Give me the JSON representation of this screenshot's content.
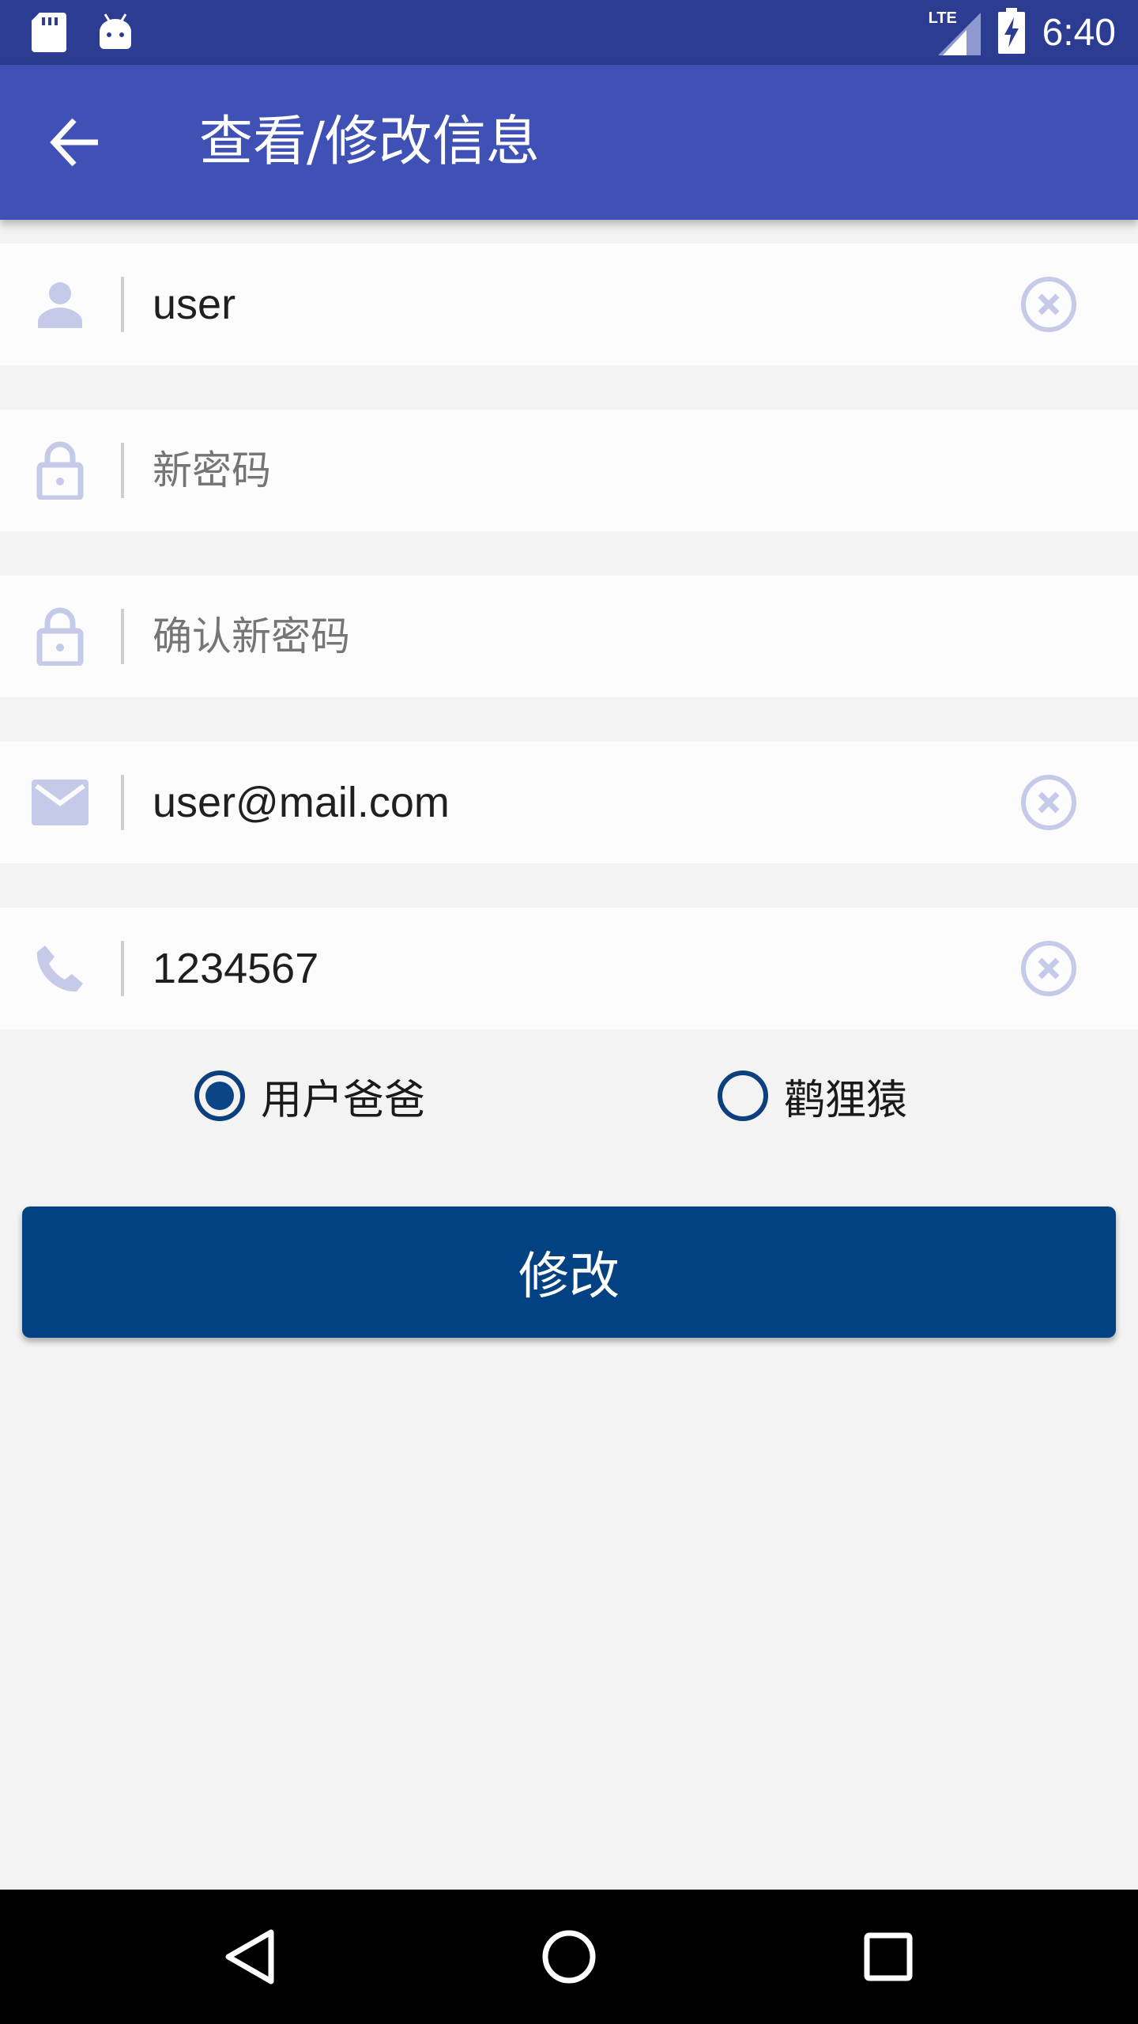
{
  "status_bar": {
    "time": "6:40",
    "network_label": "LTE",
    "icons": [
      "sd-card-icon",
      "android-icon",
      "lte-signal-icon",
      "battery-charging-icon"
    ]
  },
  "app_bar": {
    "title": "查看/修改信息",
    "back_icon": "arrow-back-icon",
    "color": "#3f51b5"
  },
  "form": {
    "username": {
      "value": "user",
      "icon": "person-icon",
      "clear_icon": "clear-circle-icon"
    },
    "new_password": {
      "placeholder": "新密码",
      "icon": "lock-icon"
    },
    "confirm_password": {
      "placeholder": "确认新密码",
      "icon": "lock-icon"
    },
    "email": {
      "value": "user@mail.com",
      "icon": "mail-icon",
      "clear_icon": "clear-circle-icon"
    },
    "phone": {
      "value": "1234567",
      "icon": "phone-icon",
      "clear_icon": "clear-circle-icon"
    }
  },
  "role": {
    "options": [
      {
        "label": "用户爸爸",
        "selected": true
      },
      {
        "label": "鹳狸猿",
        "selected": false
      }
    ]
  },
  "submit": {
    "label": "修改",
    "color": "#024283"
  },
  "nav_bar": {
    "icons": [
      "back-triangle-icon",
      "home-circle-icon",
      "recents-square-icon"
    ]
  }
}
